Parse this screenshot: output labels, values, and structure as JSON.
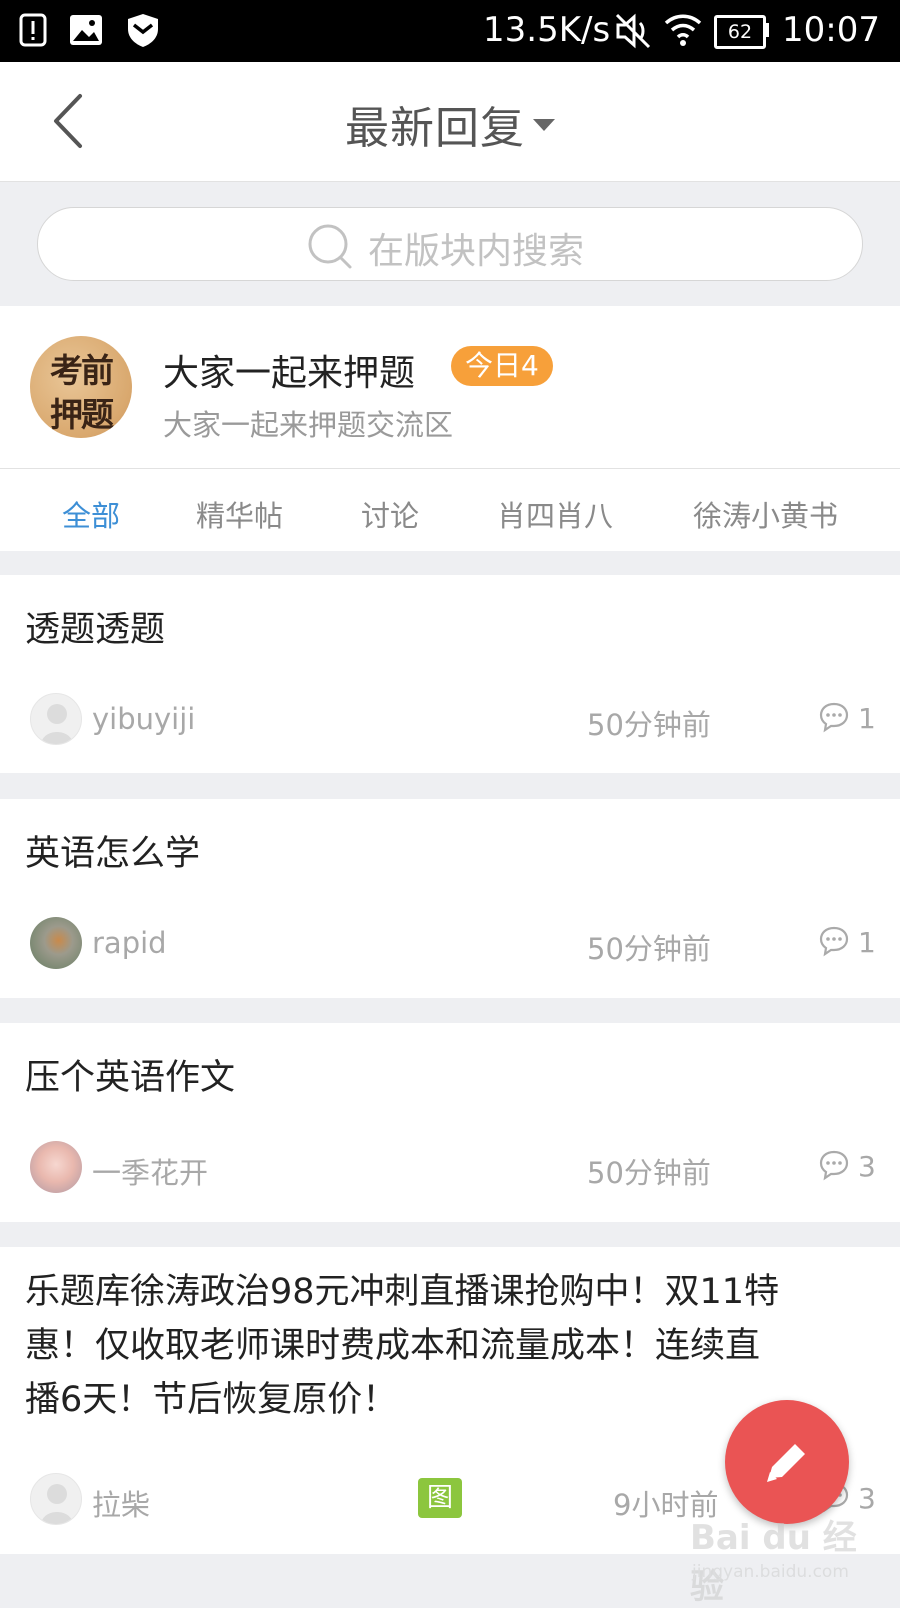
{
  "status_bar": {
    "speed": "13.5K/s",
    "battery": "62",
    "time": "10:07"
  },
  "nav": {
    "title": "最新回复"
  },
  "search": {
    "placeholder": "在版块内搜索"
  },
  "forum": {
    "logo_lines": [
      "考前",
      "押题"
    ],
    "name": "大家一起来押题",
    "today_badge": "今日4",
    "description": "大家一起来押题交流区"
  },
  "tabs": [
    {
      "label": "全部",
      "active": true
    },
    {
      "label": "精华帖",
      "active": false
    },
    {
      "label": "讨论",
      "active": false
    },
    {
      "label": "肖四肖八",
      "active": false
    },
    {
      "label": "徐涛小黄书",
      "active": false
    }
  ],
  "posts": [
    {
      "title": "透题透题",
      "author": "yibuyiji",
      "time": "50分钟前",
      "comments": "1",
      "avatar": "default-avatar-icon"
    },
    {
      "title": "英语怎么学",
      "author": "rapid",
      "time": "50分钟前",
      "comments": "1",
      "avatar": "photo-avatar"
    },
    {
      "title": "压个英语作文",
      "author": "一季花开",
      "time": "50分钟前",
      "comments": "3",
      "avatar": "photo-avatar"
    },
    {
      "title_lines": [
        "乐题库徐涛政治98元冲刺直播课抢购中！双11特",
        "惠！仅收取老师课时费成本和流量成本！连续直",
        "播6天！节后恢复原价！"
      ],
      "author": "拉柴",
      "time": "9小时前",
      "comments": "3",
      "image_tag": "图",
      "avatar": "default-avatar-icon"
    }
  ],
  "fab": {
    "icon": "pencil-icon"
  },
  "watermark": {
    "text": "Bai du 经验",
    "sub": "jingyan.baidu.com"
  },
  "colors": {
    "accent": "#3d8fd6",
    "badge": "#f7a03a",
    "fab": "#ea5454",
    "image_tag": "#8cc63e"
  }
}
